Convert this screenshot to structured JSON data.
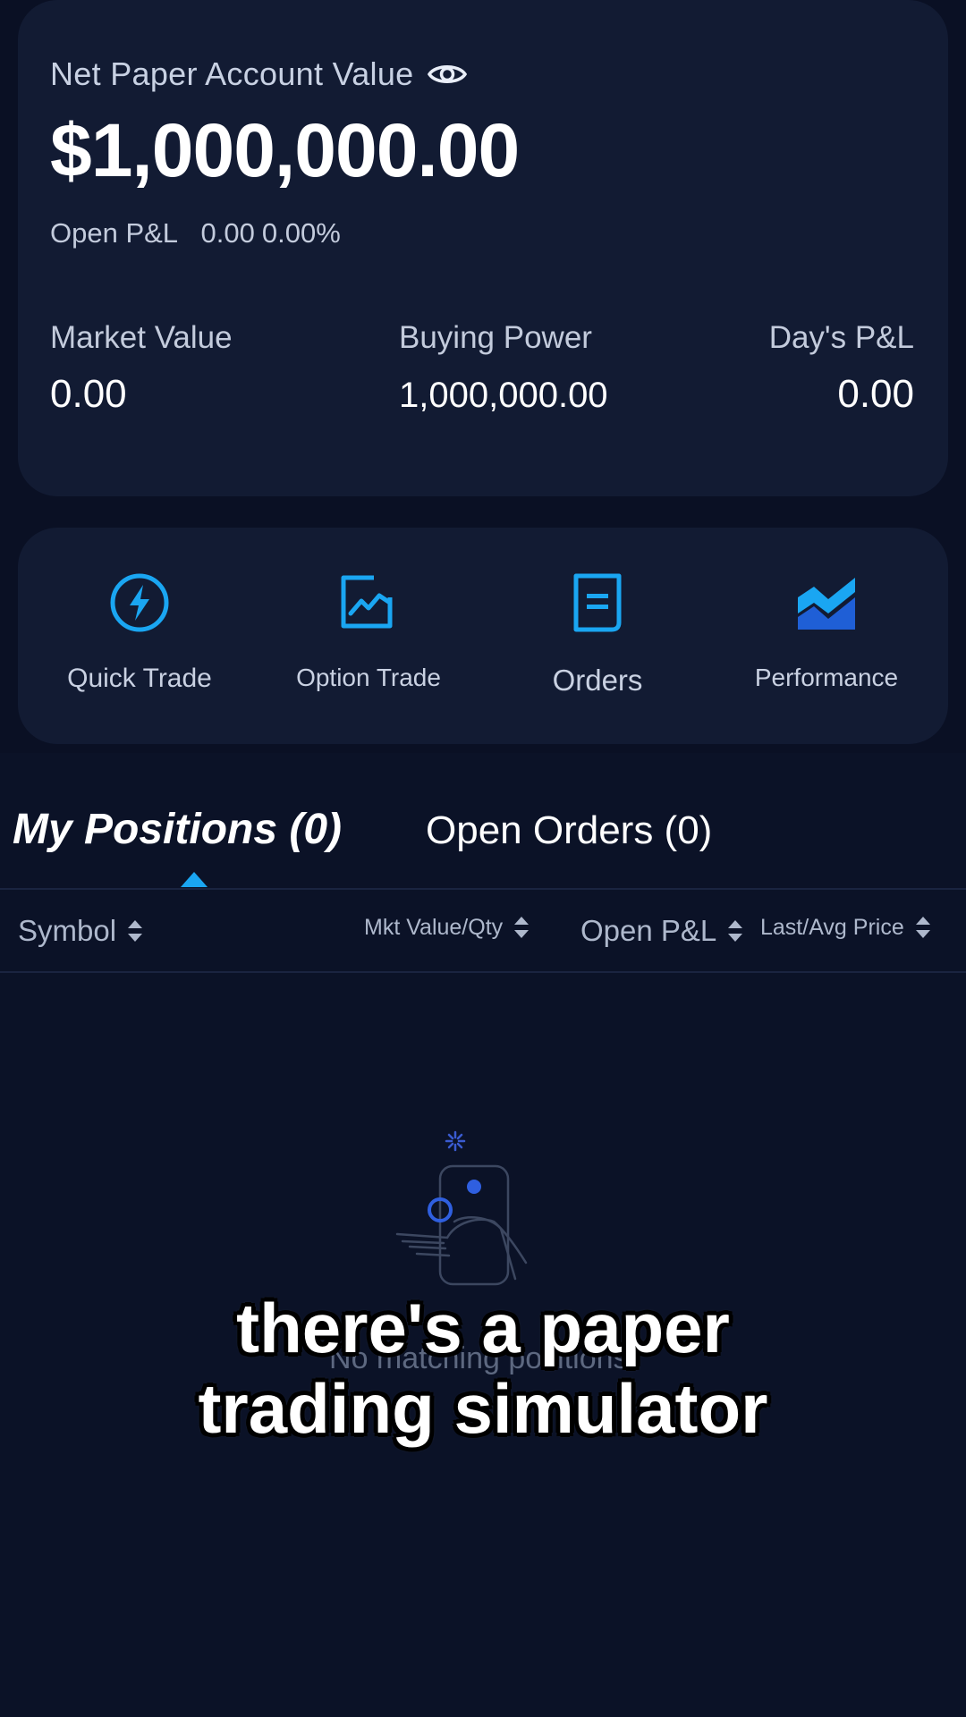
{
  "account": {
    "label": "Net Paper Account Value",
    "value": "$1,000,000.00",
    "open_pnl_label": "Open P&L",
    "open_pnl_value": "0.00",
    "open_pnl_percent": "0.00%",
    "metrics": {
      "market_value": {
        "label": "Market Value",
        "value": "0.00"
      },
      "buying_power": {
        "label": "Buying Power",
        "value": "1,000,000.00"
      },
      "days_pnl": {
        "label": "Day's P&L",
        "value": "0.00"
      }
    }
  },
  "actions": [
    {
      "label": "Quick Trade",
      "icon": "lightning-icon"
    },
    {
      "label": "Option Trade",
      "icon": "chart-window-icon"
    },
    {
      "label": "Orders",
      "icon": "document-icon"
    },
    {
      "label": "Performance",
      "icon": "area-chart-icon"
    }
  ],
  "tabs": {
    "active": "My Positions (0)",
    "inactive": "Open Orders (0)"
  },
  "columns": {
    "symbol": "Symbol",
    "mkt_value_qty": "Mkt Value/Qty",
    "open_pnl": "Open P&L",
    "last_avg_price": "Last/Avg Price"
  },
  "empty_state": {
    "text": "No matching positions."
  },
  "caption": {
    "line1": "there's a paper",
    "line2": "trading simulator"
  },
  "colors": {
    "accent": "#1aa6f2",
    "background": "#0b1227",
    "card": "#121b33"
  }
}
